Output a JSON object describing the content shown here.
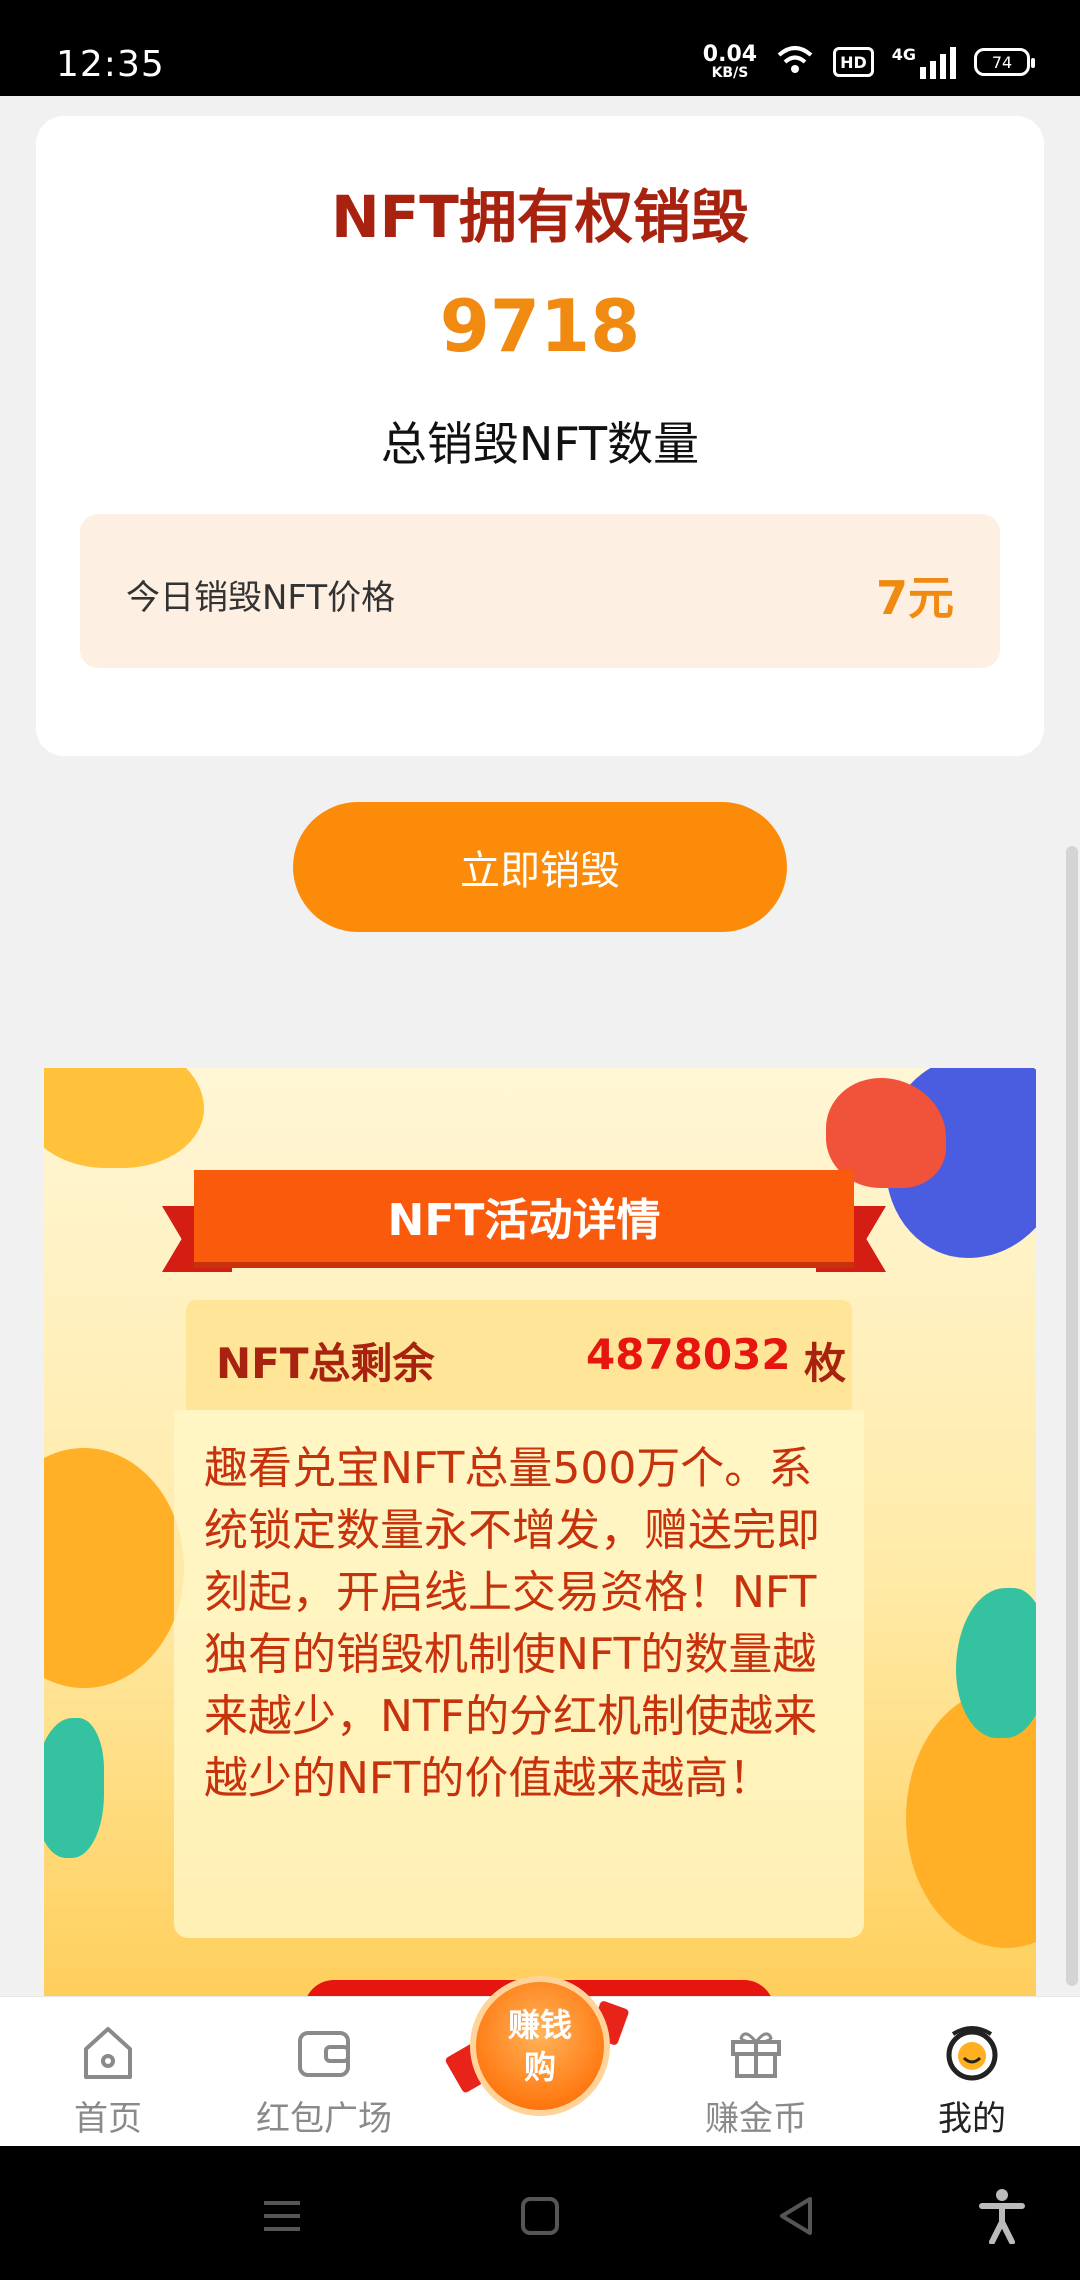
{
  "status_bar": {
    "time": "12:35",
    "net_speed_value": "0.04",
    "net_speed_unit": "KB/S",
    "hd_label": "HD",
    "network_label": "4G",
    "battery_level": "74"
  },
  "destroy_card": {
    "title": "NFT拥有权销毁",
    "total_destroyed": "9718",
    "total_label": "总销毁NFT数量",
    "price_label": "今日销毁NFT价格",
    "price_value": "7元"
  },
  "destroy_button": {
    "label": "立即销毁"
  },
  "activity": {
    "title": "NFT活动详情",
    "remaining_label": "NFT总剩余",
    "remaining_value": "4878032",
    "remaining_unit": "枚",
    "description": "趣看兑宝NFT总量500万个。系统锁定数量永不增发，赠送完即刻起，开启线上交易资格！NFT独有的销毁机制使NFT的数量越来越少，NTF的分红机制使越来越少的NFT的价值越来越高！"
  },
  "bottom_nav": {
    "items": [
      {
        "label": "首页",
        "icon": "home-icon"
      },
      {
        "label": "红包广场",
        "icon": "wallet-icon"
      },
      {
        "label": "赚金币",
        "icon": "gift-icon"
      },
      {
        "label": "我的",
        "icon": "profile-icon"
      }
    ],
    "center_button": {
      "line1": "赚钱",
      "line2": "购"
    },
    "active_index": 3
  },
  "colors": {
    "accent_orange": "#fd8b0a",
    "title_red": "#a8230f",
    "number_orange": "#f08a10",
    "price_bg": "#fdf0e3"
  }
}
